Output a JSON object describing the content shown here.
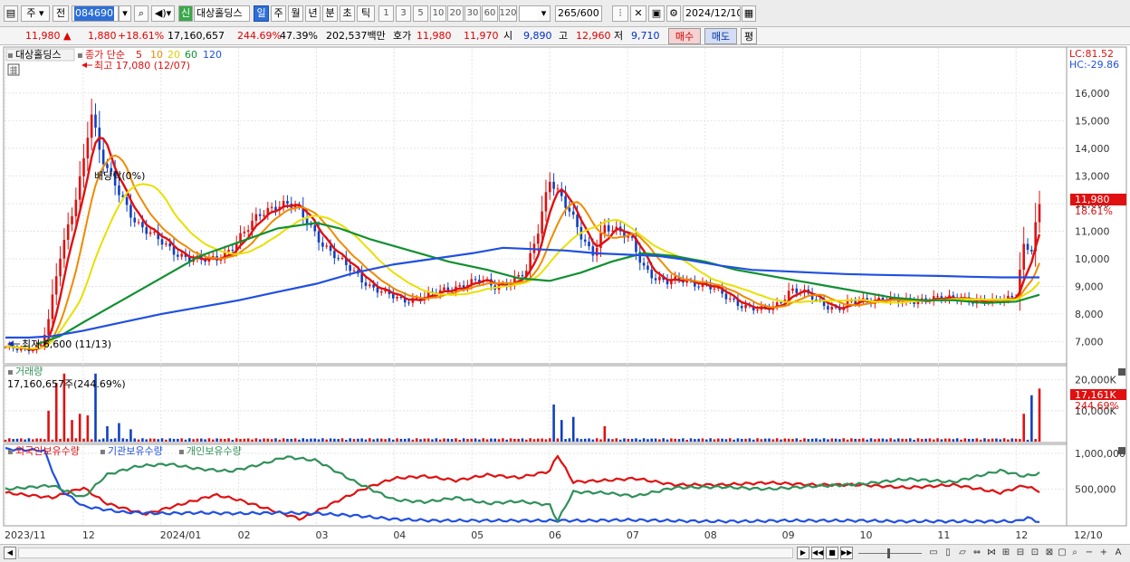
{
  "toolbar": {
    "market": "주",
    "prev": "전",
    "code": "084690",
    "new_badge": "신",
    "name": "대상홀딩스",
    "periods": [
      "일",
      "주",
      "월",
      "년",
      "분",
      "초",
      "틱"
    ],
    "active_period": "일",
    "intervals": [
      "1",
      "3",
      "5",
      "10",
      "20",
      "30",
      "60",
      "120"
    ],
    "count": "265",
    "count_max": "/600",
    "date": "2024/12/10"
  },
  "quote": {
    "price": "11,980",
    "arrow": "▲",
    "change": "1,880",
    "change_pct": "+18.61%",
    "volume": "17,160,657",
    "volume_ratio": "244.69%",
    "turnover": "47.39%",
    "amount": "202,537백만",
    "hoga_label": "호가",
    "ask": "11,980",
    "bid": "11,970",
    "open_label": "시",
    "open": "9,890",
    "high_label": "고",
    "high": "12,960",
    "low_label": "저",
    "low": "9,710",
    "buy_label": "매수",
    "sell_label": "매도",
    "avg_label": "평"
  },
  "price_panel": {
    "stock_label": "대상홀딩스",
    "ma_label": "종가 단순",
    "ma_periods": [
      {
        "label": "5",
        "color": "#e01010"
      },
      {
        "label": "10",
        "color": "#f08a00"
      },
      {
        "label": "20",
        "color": "#e8e000"
      },
      {
        "label": "60",
        "color": "#109030"
      },
      {
        "label": "120",
        "color": "#2050e0"
      }
    ],
    "max_text": "최고 17,080 (12/07)",
    "min_text": "최저 6,600 (11/13)",
    "dividend_text": "배당락(0%)",
    "lc_text": "LC:81.52",
    "hc_text": "HC:-29.86",
    "last_price": "11,980",
    "last_pct": "18.61%"
  },
  "volume_panel": {
    "title": "거래량",
    "info": "17,160,657주(244.69%)",
    "last_value": "17,161K",
    "last_pct": "244.69%"
  },
  "holding_panel": {
    "series": [
      {
        "name": "외국인보유수량",
        "color": "#e01010"
      },
      {
        "name": "기관보유수량",
        "color": "#2050e0"
      },
      {
        "name": "개인보유수량",
        "color": "#30905a"
      }
    ]
  },
  "chart_data": [
    {
      "type": "candlestick",
      "title": "대상홀딩스",
      "ylim": [
        6200,
        17600
      ],
      "y_ticks": [
        "7,000",
        "8,000",
        "9,000",
        "10,000",
        "11,000",
        "12,000",
        "13,000",
        "14,000",
        "15,000",
        "16,000"
      ],
      "y_tick_values": [
        7000,
        8000,
        9000,
        10000,
        11000,
        12000,
        13000,
        14000,
        15000,
        16000
      ],
      "x_labels": [
        "2023/11",
        "12",
        "2024/01",
        "02",
        "03",
        "04",
        "05",
        "06",
        "07",
        "08",
        "09",
        "10",
        "11",
        "12",
        "12/10"
      ],
      "x_label_months": [
        0,
        1,
        2,
        3,
        4,
        5,
        6,
        7,
        8,
        9,
        10,
        11,
        12,
        13,
        13.3
      ],
      "close_path": [
        [
          0.0,
          6800
        ],
        [
          0.25,
          6650
        ],
        [
          0.45,
          6900
        ],
        [
          0.55,
          7800
        ],
        [
          0.7,
          10000
        ],
        [
          0.85,
          11500
        ],
        [
          1.0,
          13500
        ],
        [
          1.1,
          15500
        ],
        [
          1.2,
          14000
        ],
        [
          1.3,
          13200
        ],
        [
          1.5,
          12200
        ],
        [
          1.7,
          11300
        ],
        [
          1.9,
          10800
        ],
        [
          2.1,
          10400
        ],
        [
          2.3,
          10100
        ],
        [
          2.5,
          9900
        ],
        [
          2.7,
          10000
        ],
        [
          2.9,
          10400
        ],
        [
          3.1,
          11000
        ],
        [
          3.3,
          11700
        ],
        [
          3.5,
          12000
        ],
        [
          3.7,
          11900
        ],
        [
          3.9,
          11300
        ],
        [
          4.1,
          10500
        ],
        [
          4.3,
          9900
        ],
        [
          4.5,
          9500
        ],
        [
          4.7,
          9000
        ],
        [
          4.9,
          8700
        ],
        [
          5.1,
          8500
        ],
        [
          5.3,
          8600
        ],
        [
          5.5,
          8700
        ],
        [
          5.7,
          8900
        ],
        [
          5.9,
          9100
        ],
        [
          6.1,
          9200
        ],
        [
          6.3,
          9000
        ],
        [
          6.5,
          9200
        ],
        [
          6.7,
          9500
        ],
        [
          6.85,
          11000
        ],
        [
          7.0,
          13000
        ],
        [
          7.1,
          12500
        ],
        [
          7.25,
          11700
        ],
        [
          7.4,
          10800
        ],
        [
          7.55,
          10200
        ],
        [
          7.7,
          11200
        ],
        [
          7.9,
          10900
        ],
        [
          8.05,
          10700
        ],
        [
          8.2,
          9800
        ],
        [
          8.35,
          9300
        ],
        [
          8.5,
          9100
        ],
        [
          8.7,
          9300
        ],
        [
          8.9,
          9100
        ],
        [
          9.1,
          8900
        ],
        [
          9.3,
          8600
        ],
        [
          9.5,
          8300
        ],
        [
          9.7,
          8100
        ],
        [
          9.9,
          8300
        ],
        [
          10.1,
          8900
        ],
        [
          10.3,
          8700
        ],
        [
          10.5,
          8400
        ],
        [
          10.7,
          8200
        ],
        [
          10.9,
          8400
        ],
        [
          11.1,
          8500
        ],
        [
          11.3,
          8600
        ],
        [
          11.5,
          8400
        ],
        [
          11.7,
          8500
        ],
        [
          11.9,
          8600
        ],
        [
          12.1,
          8500
        ],
        [
          12.3,
          8600
        ],
        [
          12.5,
          8500
        ],
        [
          12.7,
          8400
        ],
        [
          12.9,
          8600
        ],
        [
          13.0,
          8800
        ],
        [
          13.1,
          10500
        ],
        [
          13.2,
          10300
        ],
        [
          13.3,
          11980
        ]
      ],
      "ma120_path": [
        [
          0.0,
          7150
        ],
        [
          0.3,
          7150
        ],
        [
          0.6,
          7200
        ],
        [
          1.0,
          7400
        ],
        [
          1.5,
          7700
        ],
        [
          2.0,
          8000
        ],
        [
          2.5,
          8250
        ],
        [
          3.0,
          8500
        ],
        [
          3.5,
          8800
        ],
        [
          4.0,
          9100
        ],
        [
          4.5,
          9500
        ],
        [
          5.0,
          9800
        ],
        [
          5.5,
          10000
        ],
        [
          6.0,
          10200
        ],
        [
          6.4,
          10400
        ],
        [
          6.8,
          10350
        ],
        [
          7.2,
          10300
        ],
        [
          7.6,
          10200
        ],
        [
          8.0,
          10150
        ],
        [
          8.4,
          10100
        ],
        [
          8.8,
          9950
        ],
        [
          9.2,
          9750
        ],
        [
          9.6,
          9600
        ],
        [
          10.0,
          9550
        ],
        [
          10.4,
          9500
        ],
        [
          10.8,
          9450
        ],
        [
          11.2,
          9420
        ],
        [
          11.6,
          9400
        ],
        [
          12.0,
          9380
        ],
        [
          12.4,
          9350
        ],
        [
          12.8,
          9330
        ],
        [
          13.3,
          9330
        ]
      ],
      "ma60_path": [
        [
          0.4,
          6900
        ],
        [
          0.7,
          7200
        ],
        [
          1.0,
          7700
        ],
        [
          1.5,
          8500
        ],
        [
          2.0,
          9300
        ],
        [
          2.5,
          10100
        ],
        [
          3.0,
          10600
        ],
        [
          3.5,
          11100
        ],
        [
          4.0,
          11300
        ],
        [
          4.3,
          11100
        ],
        [
          4.7,
          10700
        ],
        [
          5.2,
          10300
        ],
        [
          5.7,
          9900
        ],
        [
          6.2,
          9600
        ],
        [
          6.6,
          9300
        ],
        [
          7.0,
          9200
        ],
        [
          7.4,
          9500
        ],
        [
          7.8,
          9900
        ],
        [
          8.2,
          10200
        ],
        [
          8.6,
          10100
        ],
        [
          9.0,
          9900
        ],
        [
          9.4,
          9600
        ],
        [
          9.8,
          9400
        ],
        [
          10.2,
          9200
        ],
        [
          10.6,
          9000
        ],
        [
          11.0,
          8800
        ],
        [
          11.4,
          8600
        ],
        [
          11.8,
          8500
        ],
        [
          12.2,
          8500
        ],
        [
          12.6,
          8400
        ],
        [
          13.0,
          8450
        ],
        [
          13.3,
          8700
        ]
      ]
    },
    {
      "type": "bar",
      "title": "거래량",
      "y_ticks": [
        "10,000K",
        "20,000K"
      ],
      "y_tick_values": [
        10000,
        20000
      ],
      "ylim": [
        0,
        24000
      ],
      "x_months_span": [
        0,
        13.3
      ],
      "spikes": [
        {
          "month": 0.55,
          "value": 10000
        },
        {
          "month": 0.65,
          "value": 19000
        },
        {
          "month": 0.75,
          "value": 22000
        },
        {
          "month": 0.85,
          "value": 7000
        },
        {
          "month": 0.95,
          "value": 9000
        },
        {
          "month": 1.05,
          "value": 8500
        },
        {
          "month": 1.15,
          "value": 22000
        },
        {
          "month": 1.3,
          "value": 5000
        },
        {
          "month": 1.45,
          "value": 6000
        },
        {
          "month": 1.6,
          "value": 4000
        },
        {
          "month": 7.05,
          "value": 12000
        },
        {
          "month": 7.15,
          "value": 7000
        },
        {
          "month": 7.3,
          "value": 8000
        },
        {
          "month": 7.7,
          "value": 5000
        },
        {
          "month": 13.1,
          "value": 9000
        },
        {
          "month": 13.2,
          "value": 15000
        },
        {
          "month": 13.3,
          "value": 17161
        }
      ]
    },
    {
      "type": "line",
      "title": "외국인보유수량",
      "y_ticks": [
        "500,000",
        "1,000,000"
      ],
      "y_tick_values": [
        500000,
        1000000
      ],
      "ylim": [
        0,
        1100000
      ],
      "series": [
        {
          "name": "외국인보유수량",
          "values": [
            [
              0,
              450000
            ],
            [
              0.6,
              380000
            ],
            [
              1.0,
              520000
            ],
            [
              1.3,
              300000
            ],
            [
              1.8,
              150000
            ],
            [
              2.3,
              300000
            ],
            [
              2.7,
              420000
            ],
            [
              3.0,
              350000
            ],
            [
              3.5,
              180000
            ],
            [
              3.8,
              80000
            ],
            [
              4.3,
              350000
            ],
            [
              4.6,
              500000
            ],
            [
              5.0,
              650000
            ],
            [
              5.4,
              680000
            ],
            [
              5.8,
              620000
            ],
            [
              6.2,
              700000
            ],
            [
              6.6,
              660000
            ],
            [
              7.0,
              750000
            ],
            [
              7.1,
              980000
            ],
            [
              7.3,
              600000
            ],
            [
              7.7,
              620000
            ],
            [
              8.1,
              650000
            ],
            [
              8.6,
              560000
            ],
            [
              9.2,
              560000
            ],
            [
              9.8,
              590000
            ],
            [
              10.4,
              560000
            ],
            [
              11.0,
              560000
            ],
            [
              11.6,
              520000
            ],
            [
              12.2,
              560000
            ],
            [
              12.8,
              450000
            ],
            [
              13.1,
              550000
            ],
            [
              13.3,
              470000
            ]
          ]
        },
        {
          "name": "기관보유수량",
          "values": [
            [
              0,
              1060000
            ],
            [
              0.5,
              1040000
            ],
            [
              0.7,
              500000
            ],
            [
              1.0,
              260000
            ],
            [
              1.5,
              180000
            ],
            [
              2.0,
              160000
            ],
            [
              2.5,
              170000
            ],
            [
              3.0,
              160000
            ],
            [
              3.5,
              170000
            ],
            [
              4.0,
              160000
            ],
            [
              4.5,
              130000
            ],
            [
              5.0,
              80000
            ],
            [
              5.5,
              60000
            ],
            [
              6.0,
              60000
            ],
            [
              6.5,
              60000
            ],
            [
              7.0,
              60000
            ],
            [
              7.5,
              60000
            ],
            [
              8.0,
              70000
            ],
            [
              8.5,
              60000
            ],
            [
              9.0,
              50000
            ],
            [
              9.5,
              50000
            ],
            [
              10.0,
              60000
            ],
            [
              10.5,
              60000
            ],
            [
              11.0,
              60000
            ],
            [
              11.5,
              50000
            ],
            [
              12.0,
              50000
            ],
            [
              12.6,
              50000
            ],
            [
              13.0,
              50000
            ],
            [
              13.15,
              100000
            ],
            [
              13.3,
              40000
            ]
          ]
        },
        {
          "name": "개인보유수량",
          "values": [
            [
              0,
              500000
            ],
            [
              0.6,
              550000
            ],
            [
              1.0,
              380000
            ],
            [
              1.3,
              700000
            ],
            [
              1.7,
              820000
            ],
            [
              2.1,
              850000
            ],
            [
              2.5,
              780000
            ],
            [
              2.9,
              750000
            ],
            [
              3.3,
              850000
            ],
            [
              3.6,
              950000
            ],
            [
              4.0,
              900000
            ],
            [
              4.5,
              600000
            ],
            [
              5.0,
              350000
            ],
            [
              5.4,
              320000
            ],
            [
              5.8,
              380000
            ],
            [
              6.2,
              300000
            ],
            [
              6.6,
              330000
            ],
            [
              7.0,
              280000
            ],
            [
              7.1,
              50000
            ],
            [
              7.3,
              460000
            ],
            [
              7.7,
              450000
            ],
            [
              8.1,
              400000
            ],
            [
              8.6,
              520000
            ],
            [
              9.2,
              530000
            ],
            [
              9.8,
              500000
            ],
            [
              10.4,
              540000
            ],
            [
              11.0,
              570000
            ],
            [
              11.6,
              640000
            ],
            [
              12.2,
              600000
            ],
            [
              12.8,
              760000
            ],
            [
              13.1,
              680000
            ],
            [
              13.3,
              720000
            ]
          ]
        }
      ]
    }
  ]
}
